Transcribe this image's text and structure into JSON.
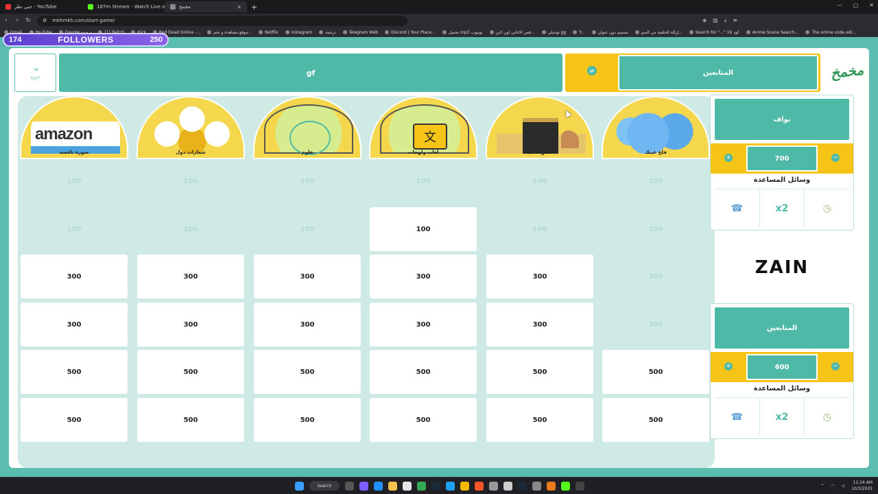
{
  "browser": {
    "tabs": [
      {
        "label": "حبي نظر - YouTube",
        "color": "#e33"
      },
      {
        "label": "187m Stream - Watch Live on Kick",
        "color": "#53fc18"
      },
      {
        "label": "مخمخ",
        "color": "#888"
      }
    ],
    "url": "mkhmkh.com/start-game/",
    "bookmarks": [
      "Gmail",
      "YouTube",
      "Google ترجمة",
      "(1) Twitch",
      "Kick",
      "Red Dead Online -...",
      "موقع مشاهدة و تحم...",
      "Netflix",
      "Instagram",
      "ترجمة",
      "Telegram Web",
      "Discord | Your Place...",
      "تحميل mp3 يوتيوب",
      "قص الاغاني اون لاين...",
      "توجيلي gg",
      "Y...",
      "تصميم دون عنوان",
      "إزالة الخلفية من الصو...",
      "Search for \"...\" 16 كود",
      "Anime Scene Search...",
      "The online code edi..."
    ]
  },
  "followers": {
    "count": "174",
    "label": "FOLLOWERS",
    "goal": "250"
  },
  "header": {
    "exit_label": "خروج",
    "team_a_name": "gf",
    "current_team": "المتابعين",
    "logo_text": "مخمخ"
  },
  "board": {
    "categories": [
      {
        "name": "صورة ناقصة",
        "art": "amazon"
      },
      {
        "name": "شعارات دول",
        "art": "flags"
      },
      {
        "name": "علوم",
        "art": "science"
      },
      {
        "name": "لغات ولهجات",
        "art": "lang"
      },
      {
        "name": "قصص الأنبياء",
        "art": "kaaba"
      },
      {
        "name": "فلح عينك",
        "art": "spots"
      }
    ],
    "rows": [
      [
        "100",
        "100",
        "100",
        "100",
        "100",
        "100"
      ],
      [
        "100",
        "100",
        "100",
        "100",
        "100",
        "100"
      ],
      [
        "300",
        "300",
        "300",
        "300",
        "300",
        "300"
      ],
      [
        "300",
        "300",
        "300",
        "300",
        "300",
        "300"
      ],
      [
        "500",
        "500",
        "500",
        "500",
        "500",
        "500"
      ],
      [
        "500",
        "500",
        "500",
        "500",
        "500",
        "500"
      ]
    ],
    "used": [
      [
        true,
        true,
        true,
        true,
        true,
        true
      ],
      [
        true,
        true,
        true,
        false,
        true,
        true
      ],
      [
        false,
        false,
        false,
        false,
        false,
        true
      ],
      [
        false,
        false,
        false,
        false,
        false,
        true
      ],
      [
        false,
        false,
        false,
        false,
        false,
        false
      ],
      [
        false,
        false,
        false,
        false,
        false,
        false
      ]
    ]
  },
  "teams": [
    {
      "name": "نواف",
      "score": "700",
      "aids_title": "وسائل المساعدة",
      "aids": [
        "phone-icon",
        "x2",
        "timer-icon"
      ]
    },
    {
      "name": "المتابعين",
      "score": "600",
      "aids_title": "وسائل المساعدة",
      "aids": [
        "phone-icon",
        "x2",
        "timer-icon"
      ]
    }
  ],
  "sponsor": "ZAIN",
  "taskbar": {
    "search_label": "Search",
    "time": "11:24 AM",
    "date": "10/3/2025"
  },
  "colors": {
    "teal": "#4fb9a8",
    "yellow": "#f5c417",
    "used_cell": "#cfe9e5"
  }
}
